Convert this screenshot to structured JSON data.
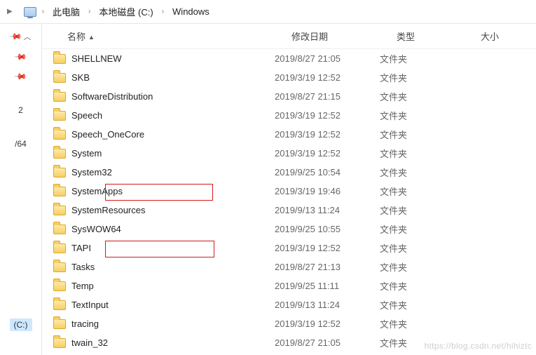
{
  "breadcrumb": {
    "items": [
      "此电脑",
      "本地磁盘 (C:)",
      "Windows"
    ]
  },
  "headers": {
    "name": "名称",
    "modified": "修改日期",
    "type": "类型",
    "size": "大小"
  },
  "sidebar": {
    "tree1": "2",
    "tree2": "/64",
    "tree3": "(C:)"
  },
  "files": [
    {
      "name": "SHELLNEW",
      "date": "2019/8/27 21:05",
      "type": "文件夹"
    },
    {
      "name": "SKB",
      "date": "2019/3/19 12:52",
      "type": "文件夹"
    },
    {
      "name": "SoftwareDistribution",
      "date": "2019/8/27 21:15",
      "type": "文件夹"
    },
    {
      "name": "Speech",
      "date": "2019/3/19 12:52",
      "type": "文件夹"
    },
    {
      "name": "Speech_OneCore",
      "date": "2019/3/19 12:52",
      "type": "文件夹"
    },
    {
      "name": "System",
      "date": "2019/3/19 12:52",
      "type": "文件夹"
    },
    {
      "name": "System32",
      "date": "2019/9/25 10:54",
      "type": "文件夹"
    },
    {
      "name": "SystemApps",
      "date": "2019/3/19 19:46",
      "type": "文件夹"
    },
    {
      "name": "SystemResources",
      "date": "2019/9/13 11:24",
      "type": "文件夹"
    },
    {
      "name": "SysWOW64",
      "date": "2019/9/25 10:55",
      "type": "文件夹"
    },
    {
      "name": "TAPI",
      "date": "2019/3/19 12:52",
      "type": "文件夹"
    },
    {
      "name": "Tasks",
      "date": "2019/8/27 21:13",
      "type": "文件夹"
    },
    {
      "name": "Temp",
      "date": "2019/9/25 11:11",
      "type": "文件夹"
    },
    {
      "name": "TextInput",
      "date": "2019/9/13 11:24",
      "type": "文件夹"
    },
    {
      "name": "tracing",
      "date": "2019/3/19 12:52",
      "type": "文件夹"
    },
    {
      "name": "twain_32",
      "date": "2019/8/27 21:05",
      "type": "文件夹"
    }
  ],
  "watermark": "https://blog.csdn.net/hihiztc"
}
